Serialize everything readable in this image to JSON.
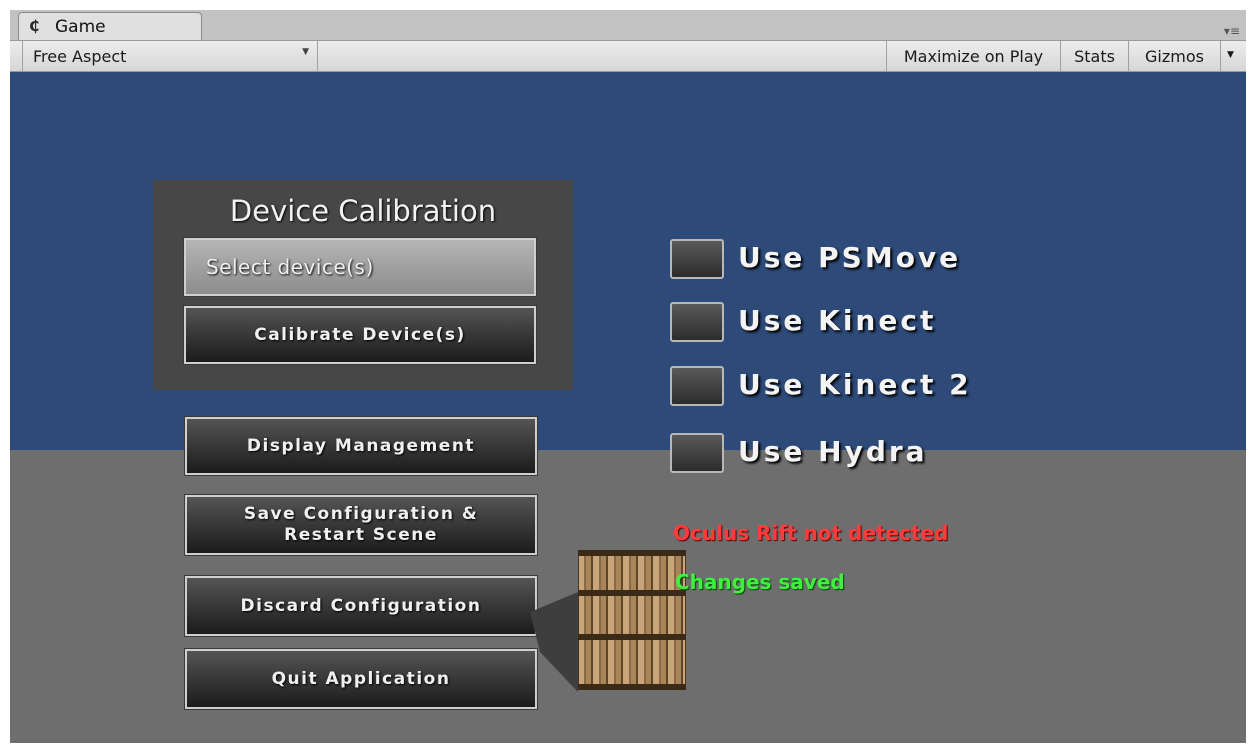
{
  "window": {
    "tab_label": "Game",
    "unity_icon": "unity-icon"
  },
  "toolbar": {
    "aspect_dropdown": "Free Aspect",
    "maximize_on_play": "Maximize on Play",
    "stats": "Stats",
    "gizmos": "Gizmos"
  },
  "calibration": {
    "title": "Device Calibration",
    "select_device": "Select device(s)",
    "calibrate": "Calibrate Device(s)"
  },
  "menu": {
    "display_management": "Display Management",
    "save_line1": "Save Configuration &",
    "save_line2": "Restart Scene",
    "discard": "Discard Configuration",
    "quit": "Quit Application"
  },
  "toggles": [
    {
      "label": "Use PSMove",
      "checked": false
    },
    {
      "label": "Use Kinect",
      "checked": false
    },
    {
      "label": "Use Kinect 2",
      "checked": false
    },
    {
      "label": "Use Hydra",
      "checked": false
    }
  ],
  "status": {
    "oculus": "Oculus Rift not detected",
    "saved": "Changes saved"
  },
  "colors": {
    "sky": "#2d4a78",
    "floor": "#6e6e6e",
    "status_error": "#ff3b3b",
    "status_ok": "#3ff03f"
  }
}
